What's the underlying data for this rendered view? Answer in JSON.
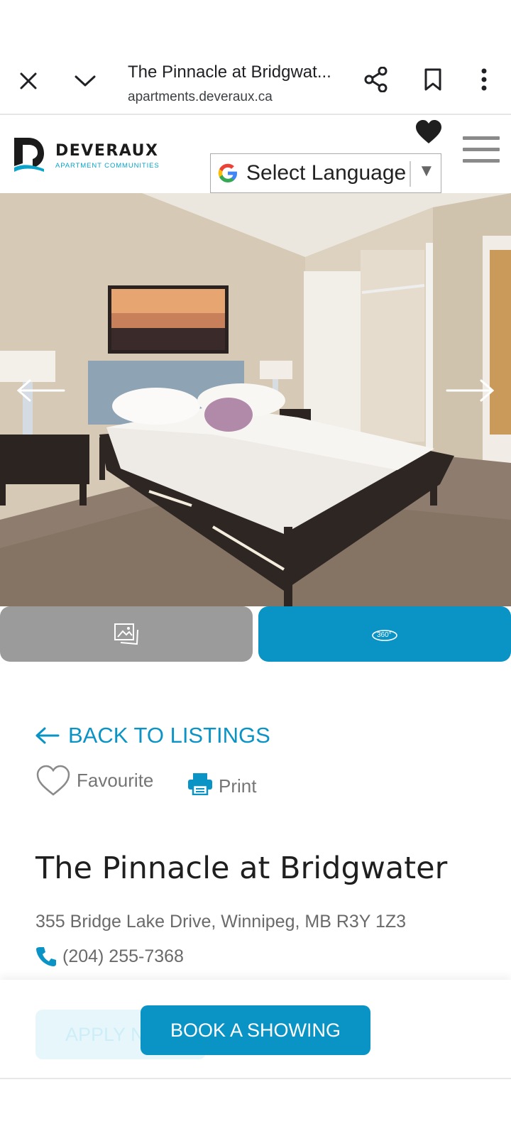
{
  "browser": {
    "page_title": "The Pinnacle at Bridgwat...",
    "url": "apartments.deveraux.ca"
  },
  "header": {
    "logo_text": "DEVERAUX",
    "logo_subtext": "APARTMENT COMMUNITIES",
    "language_select": "Select Language"
  },
  "media": {
    "gallery_icon": "gallery-icon",
    "tour_icon": "360-icon",
    "tour_icon_text": "360°"
  },
  "content": {
    "back_link": "BACK TO LISTINGS",
    "favourite_label": "Favourite",
    "print_label": "Print",
    "title": "The Pinnacle at Bridgwater",
    "address": "355 Bridge Lake Drive, Winnipeg, MB R3Y 1Z3",
    "phone": "(204) 255-7368"
  },
  "actions": {
    "apply_label": "APPLY NOW",
    "book_label": "BOOK A SHOWING"
  },
  "colors": {
    "accent": "#0a93c5",
    "gallery_button": "#9b9b9b",
    "brand_teal": "#0aa3c9"
  }
}
